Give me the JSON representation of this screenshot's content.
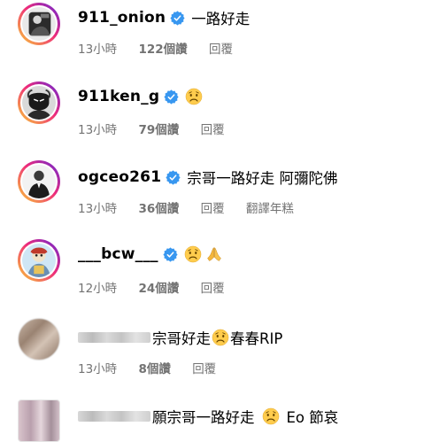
{
  "comments": [
    {
      "username": "911_onion",
      "verified": true,
      "text": "一路好走",
      "emoji": "",
      "time": "13小時",
      "likes": "122個讚",
      "reply": "回覆",
      "translate": ""
    },
    {
      "username": "911ken_g",
      "verified": true,
      "text": "",
      "emoji": "sad-face",
      "time": "13小時",
      "likes": "79個讚",
      "reply": "回覆",
      "translate": ""
    },
    {
      "username": "ogceo261",
      "verified": true,
      "text": "宗哥一路好走 阿彌陀佛",
      "emoji": "",
      "time": "13小時",
      "likes": "36個讚",
      "reply": "回覆",
      "translate": "翻譯年糕"
    },
    {
      "username": "___bcw___",
      "verified": true,
      "text": "",
      "emoji": "sad-face, folded-hands",
      "time": "12小時",
      "likes": "24個讚",
      "reply": "回覆",
      "translate": ""
    },
    {
      "username": "",
      "verified": false,
      "text_before": "宗哥好走",
      "text_after": "春春RIP",
      "emoji": "sad-face",
      "time": "13小時",
      "likes": "8個讚",
      "reply": "回覆",
      "translate": ""
    },
    {
      "username": "",
      "verified": false,
      "text_before": "願宗哥一路好走",
      "text_after": "Eo 節哀",
      "emoji": "sad-face",
      "time": "",
      "likes": "",
      "reply": "",
      "translate": ""
    }
  ],
  "colors": {
    "verified_badge": "#3897f0",
    "meta_text": "#737373",
    "story_ring": [
      "#f9ce34",
      "#ee2a7b",
      "#6228d7"
    ]
  }
}
